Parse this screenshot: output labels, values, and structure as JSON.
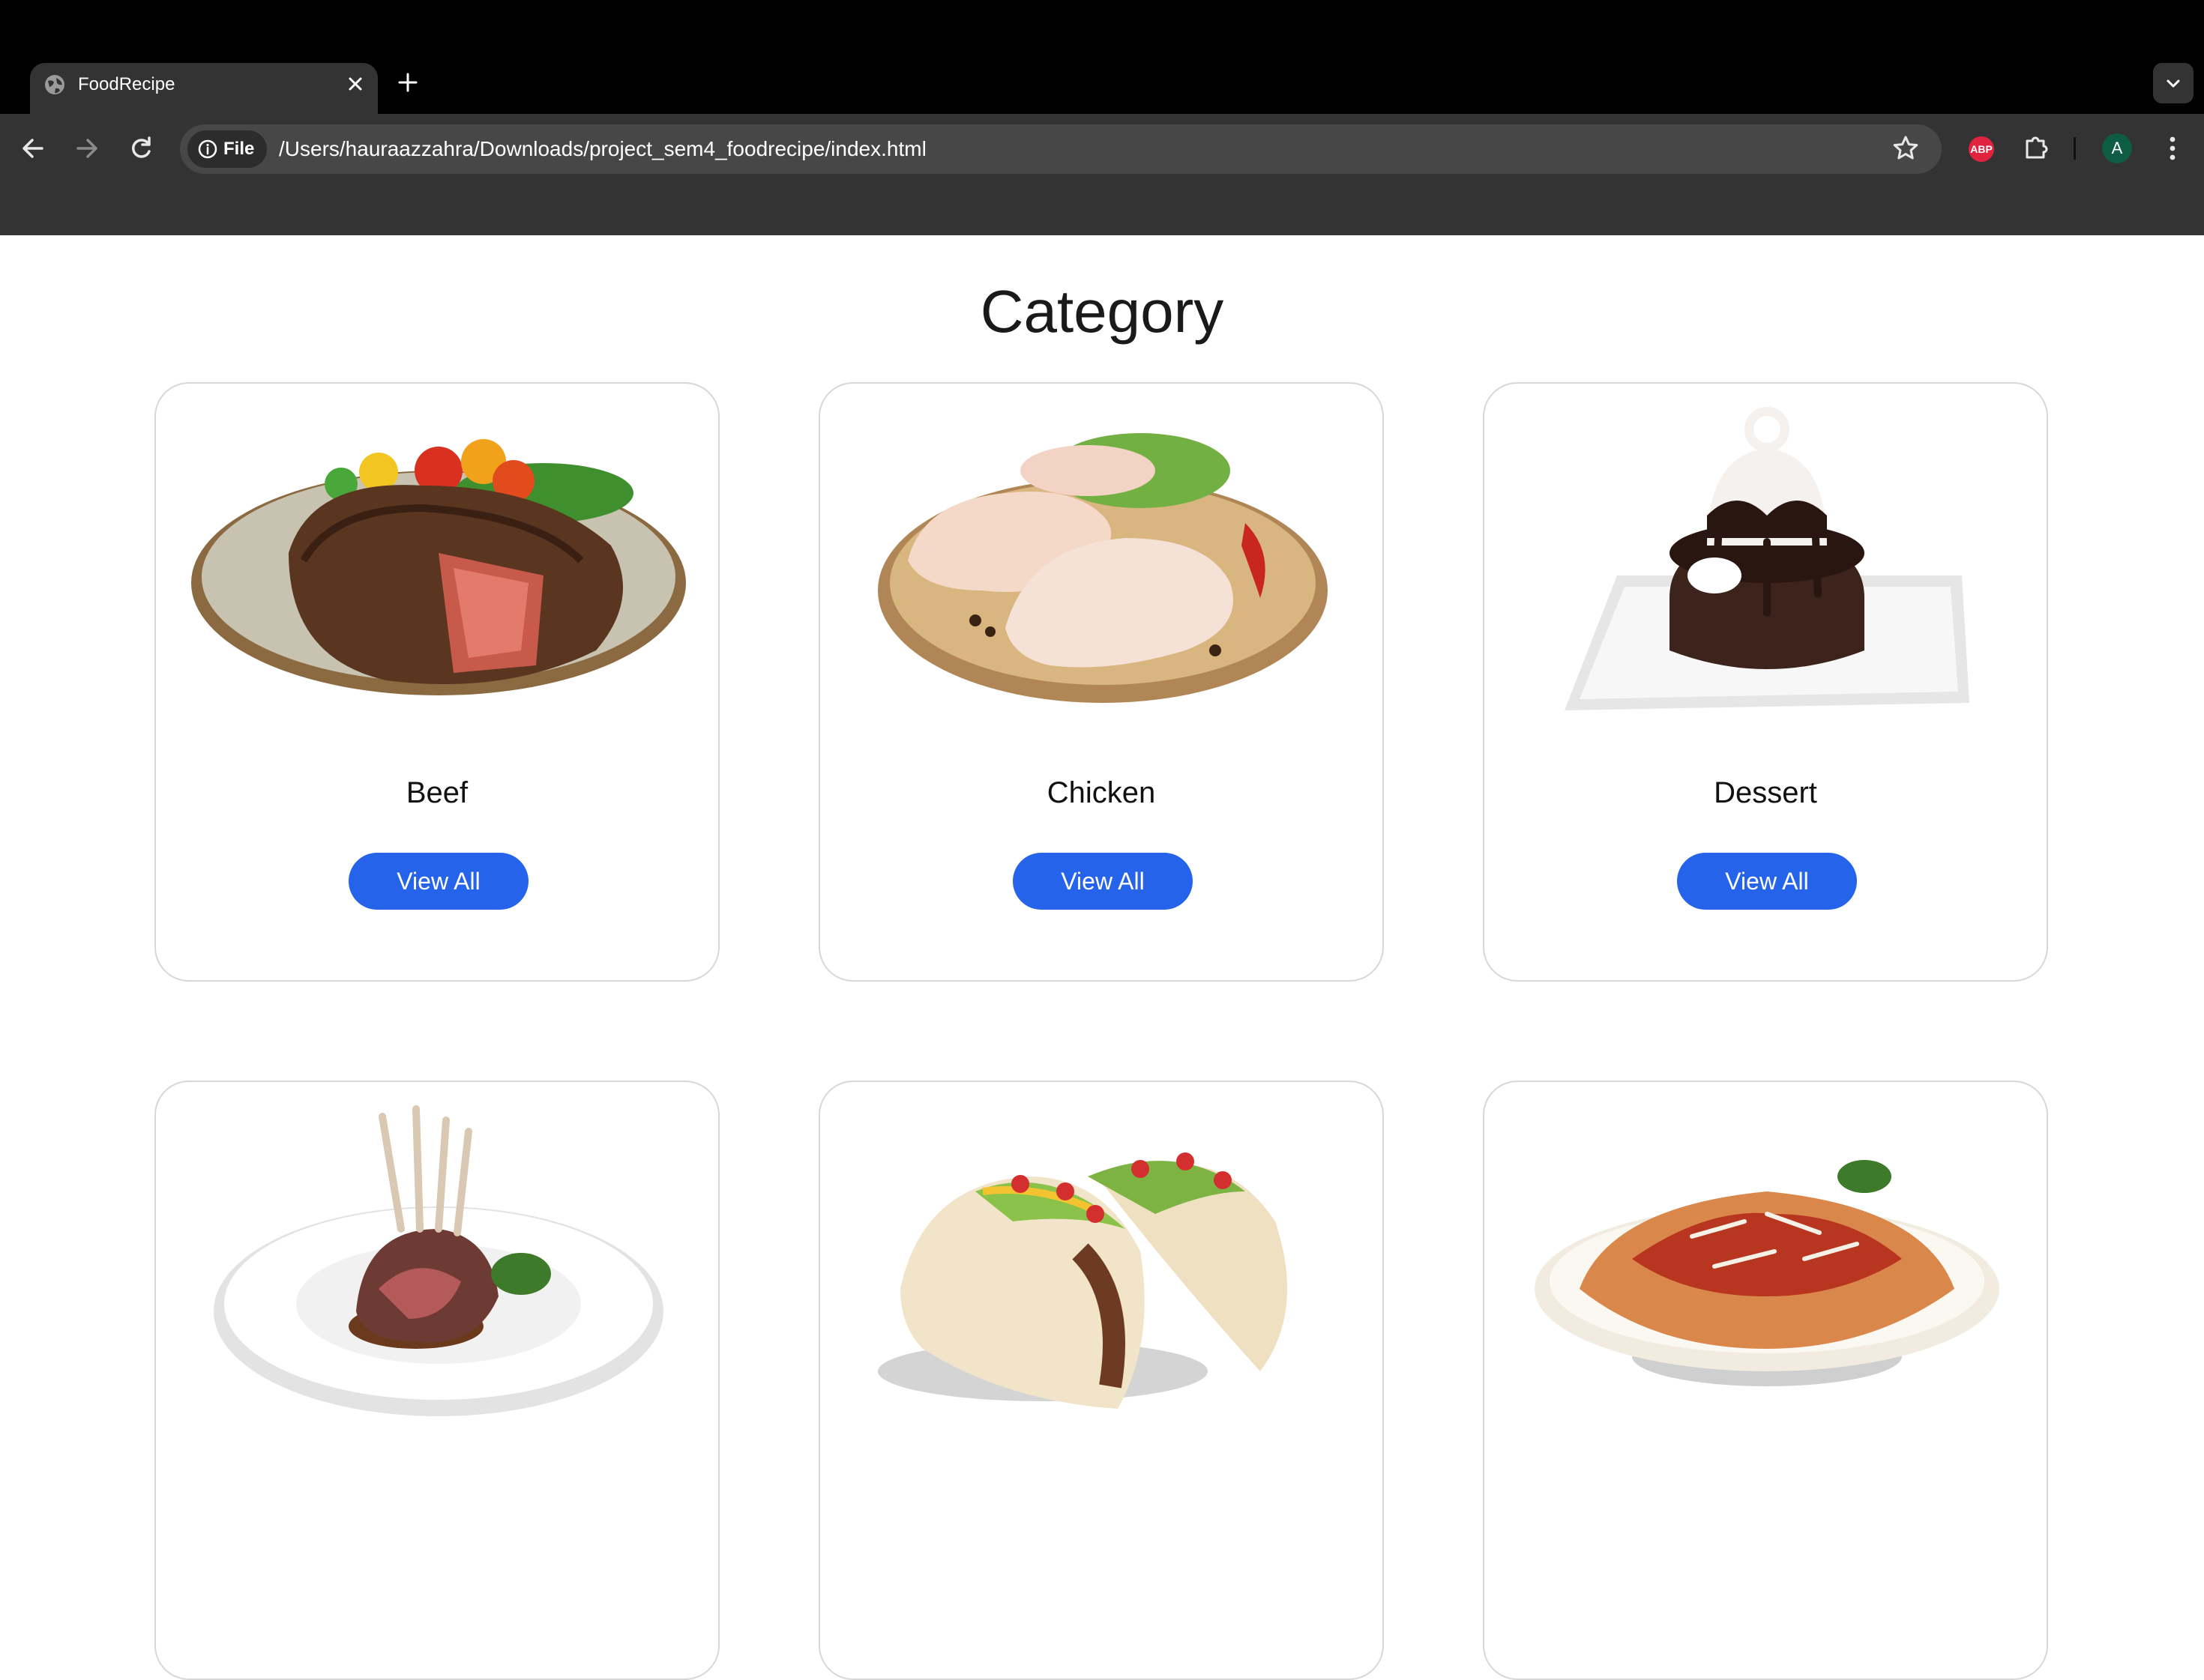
{
  "browser": {
    "tab_title": "FoodRecipe",
    "site_chip": "File",
    "url": "/Users/hauraazzahra/Downloads/project_sem4_foodrecipe/index.html",
    "adblock_label": "ABP",
    "profile_initial": "A"
  },
  "page": {
    "heading": "Category",
    "categories": [
      {
        "name": "Beef",
        "button": "View All"
      },
      {
        "name": "Chicken",
        "button": "View All"
      },
      {
        "name": "Dessert",
        "button": "View All"
      },
      {
        "name": "",
        "button": ""
      },
      {
        "name": "",
        "button": ""
      },
      {
        "name": "",
        "button": ""
      }
    ]
  },
  "colors": {
    "accent": "#2563eb",
    "toolbar": "#333333",
    "titlebar": "#000000"
  }
}
